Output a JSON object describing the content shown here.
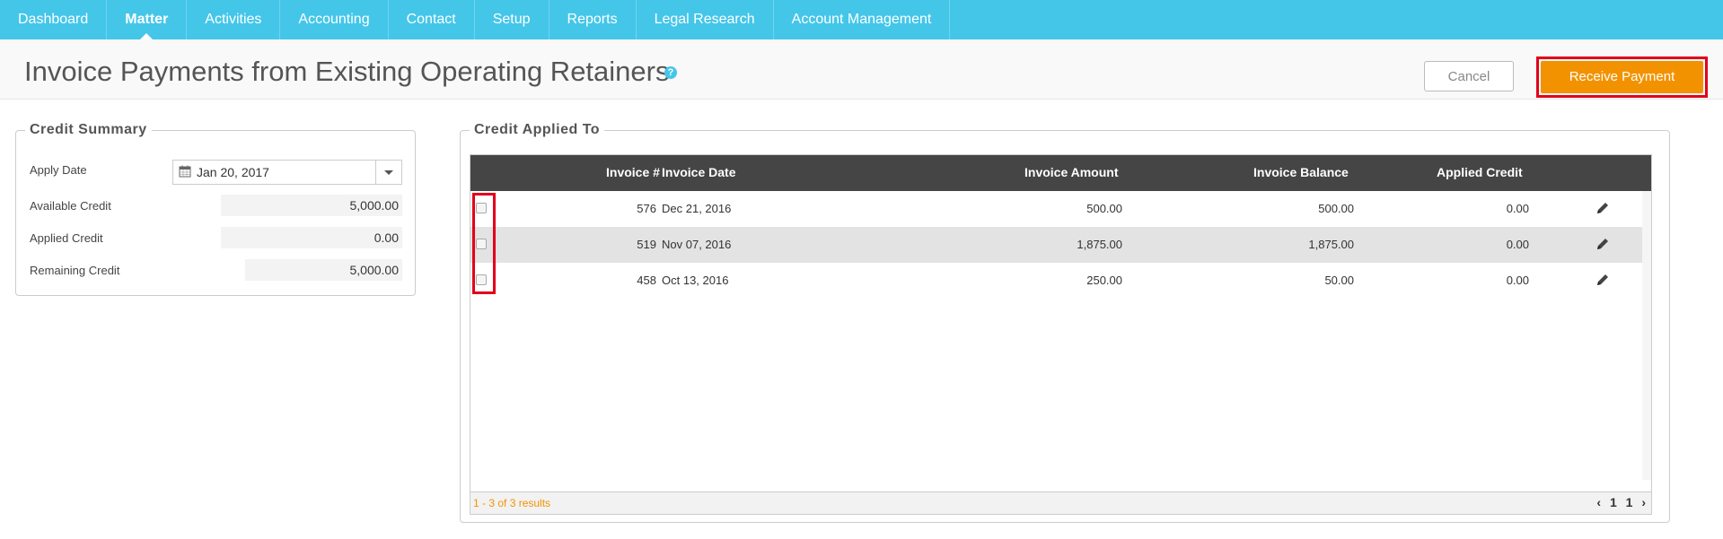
{
  "nav": {
    "items": [
      {
        "label": "Dashboard",
        "active": false
      },
      {
        "label": "Matter",
        "active": true
      },
      {
        "label": "Activities",
        "active": false
      },
      {
        "label": "Accounting",
        "active": false
      },
      {
        "label": "Contact",
        "active": false
      },
      {
        "label": "Setup",
        "active": false
      },
      {
        "label": "Reports",
        "active": false
      },
      {
        "label": "Legal Research",
        "active": false
      },
      {
        "label": "Account Management",
        "active": false
      }
    ]
  },
  "header": {
    "title": "Invoice Payments from Existing Operating Retainers",
    "help_icon": "question-circle-icon",
    "help_glyph": "?",
    "cancel_label": "Cancel",
    "receive_label": "Receive Payment"
  },
  "credit_summary": {
    "legend": "Credit Summary",
    "apply_date_label": "Apply Date",
    "apply_date_value": "Jan 20, 2017",
    "available_label": "Available Credit",
    "available_value": "5,000.00",
    "applied_label": "Applied Credit",
    "applied_value": "0.00",
    "remaining_label": "Remaining Credit",
    "remaining_value": "5,000.00"
  },
  "credit_applied": {
    "legend": "Credit Applied To",
    "columns": {
      "invoice_no": "Invoice #",
      "invoice_date": "Invoice Date",
      "invoice_amount": "Invoice Amount",
      "invoice_balance": "Invoice Balance",
      "applied_credit": "Applied Credit"
    },
    "rows": [
      {
        "invoice_no": "576",
        "invoice_date": "Dec 21, 2016",
        "invoice_amount": "500.00",
        "invoice_balance": "500.00",
        "applied_credit": "0.00"
      },
      {
        "invoice_no": "519",
        "invoice_date": "Nov 07, 2016",
        "invoice_amount": "1,875.00",
        "invoice_balance": "1,875.00",
        "applied_credit": "0.00"
      },
      {
        "invoice_no": "458",
        "invoice_date": "Oct 13, 2016",
        "invoice_amount": "250.00",
        "invoice_balance": "50.00",
        "applied_credit": "0.00"
      }
    ],
    "results_text": "1 - 3 of 3 results",
    "pager": {
      "prev": "‹",
      "page": "1",
      "total": "1",
      "next": "›"
    }
  },
  "colors": {
    "nav_bg": "#44c6e9",
    "primary_button": "#f39200",
    "highlight": "#e2001a",
    "table_header": "#454545"
  }
}
